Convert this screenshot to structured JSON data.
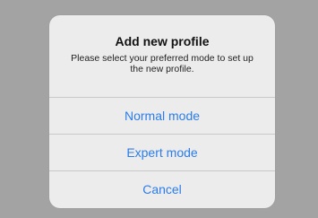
{
  "dialog": {
    "title": "Add new profile",
    "message": "Please select your preferred mode to set up the new profile.",
    "actions": [
      {
        "label": "Normal mode"
      },
      {
        "label": "Expert mode"
      },
      {
        "label": "Cancel"
      }
    ]
  },
  "colors": {
    "backdrop": "#a3a3a3",
    "dialog_background": "#ececec",
    "action_text": "#2b7de9"
  }
}
